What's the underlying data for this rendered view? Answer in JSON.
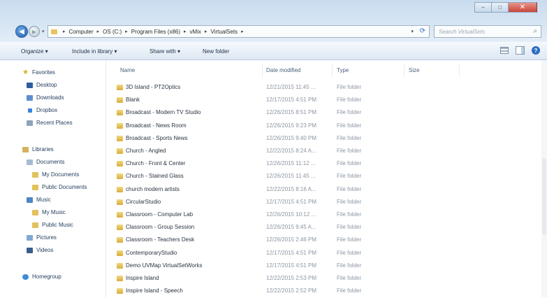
{
  "window": {
    "min": "–",
    "max": "□",
    "close": "✕"
  },
  "address": {
    "crumbs": [
      "Computer",
      "OS (C:)",
      "Program Files (x86)",
      "vMix",
      "VirtualSets"
    ],
    "search_placeholder": "Search VirtualSets"
  },
  "toolbar": {
    "organize": "Organize ▾",
    "include": "Include in library ▾",
    "share": "Share with ▾",
    "newfolder": "New folder"
  },
  "nav": {
    "favorites": "Favorites",
    "desktop": "Desktop",
    "downloads": "Downloads",
    "dropbox": "Dropbox",
    "recent": "Recent Places",
    "libraries": "Libraries",
    "documents": "Documents",
    "mydocs": "My Documents",
    "pubdocs": "Public Documents",
    "music": "Music",
    "mymusic": "My Music",
    "pubmusic": "Public Music",
    "pictures": "Pictures",
    "videos": "Videos",
    "homegroup": "Homegroup"
  },
  "columns": {
    "name": "Name",
    "date": "Date modified",
    "type": "Type",
    "size": "Size"
  },
  "files": [
    {
      "name": "3D Island - PT2Optics",
      "date": "12/21/2015 11:45 ...",
      "type": "File folder"
    },
    {
      "name": "Blank",
      "date": "12/17/2015 4:51 PM",
      "type": "File folder"
    },
    {
      "name": "Broadcast - Modern TV Studio",
      "date": "12/26/2015 8:51 PM",
      "type": "File folder"
    },
    {
      "name": "Broadcast - News Room",
      "date": "12/26/2015 9:23 PM",
      "type": "File folder"
    },
    {
      "name": "Broadcast - Sports News",
      "date": "12/26/2015 9:40 PM",
      "type": "File folder"
    },
    {
      "name": "Church - Angled",
      "date": "12/22/2015 8:24 A...",
      "type": "File folder"
    },
    {
      "name": "Church - Front & Center",
      "date": "12/26/2015 11:12 ...",
      "type": "File folder"
    },
    {
      "name": "Church - Stained Glass",
      "date": "12/26/2015 11:45 ...",
      "type": "File folder"
    },
    {
      "name": "church modern artists",
      "date": "12/22/2015 8:16 A...",
      "type": "File folder"
    },
    {
      "name": "CircularStudio",
      "date": "12/17/2015 4:51 PM",
      "type": "File folder"
    },
    {
      "name": "Classroom - Computer Lab",
      "date": "12/26/2015 10:12 ...",
      "type": "File folder"
    },
    {
      "name": "Classroom - Group Session",
      "date": "12/26/2015 9:45 A...",
      "type": "File folder"
    },
    {
      "name": "Classroom - Teachers Desk",
      "date": "12/26/2015 2:46 PM",
      "type": "File folder"
    },
    {
      "name": "ContemporaryStudio",
      "date": "12/17/2015 4:51 PM",
      "type": "File folder"
    },
    {
      "name": "Demo UVMap VirtualSetWorks",
      "date": "12/17/2015 4:51 PM",
      "type": "File folder"
    },
    {
      "name": "Inspire Island",
      "date": "12/22/2015 2:53 PM",
      "type": "File folder"
    },
    {
      "name": "Inspire Island - Speech",
      "date": "12/22/2015 2:52 PM",
      "type": "File folder"
    }
  ]
}
